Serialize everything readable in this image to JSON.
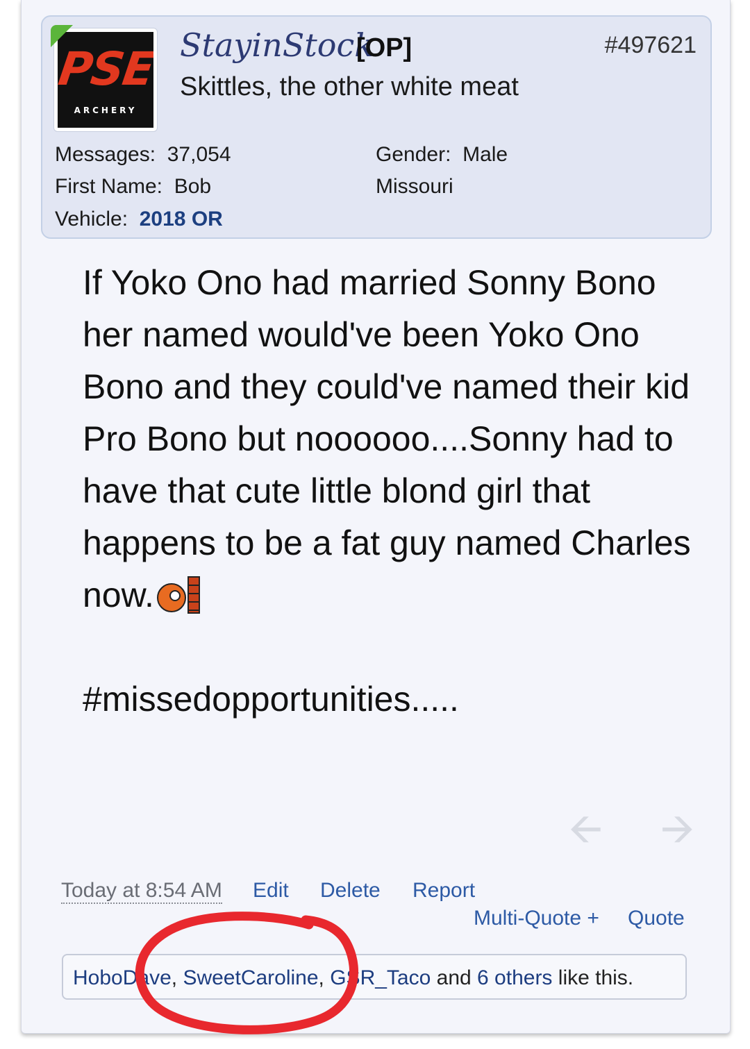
{
  "post": {
    "number": "#497621",
    "message_lines": [
      "If Yoko Ono had married Sonny Bono her named would've been Yoko Ono Bono and they could've named their kid Pro Bono but noooooo....Sonny had to have that cute little blond girl that happens to be a fat guy named Charles now."
    ],
    "hashtag": "#missedopportunities.....",
    "smiley_icon": "head-bang-wall-icon"
  },
  "user": {
    "avatar_logo": "PSE",
    "avatar_sub": "ARCHERY",
    "name": "StayinStock",
    "op_tag": "[OP]",
    "title": "Skittles, the other white meat",
    "stats": {
      "messages_label": "Messages:",
      "messages_value": "37,054",
      "first_name_label": "First Name:",
      "first_name_value": "Bob",
      "vehicle_label": "Vehicle:",
      "vehicle_value": "2018 OR",
      "gender_label": "Gender:",
      "gender_value": "Male",
      "location": "Missouri"
    }
  },
  "controls": {
    "timestamp": "Today at 8:54 AM",
    "edit": "Edit",
    "delete": "Delete",
    "report": "Report",
    "multi_quote": "Multi-Quote +",
    "quote": "Quote",
    "prev_icon": "arrow-left-icon",
    "next_icon": "arrow-right-icon"
  },
  "likes": {
    "users": [
      "HoboDave",
      "SweetCaroline",
      "GSR_Taco"
    ],
    "sep": ", ",
    "and_text": " and ",
    "others": "6 others",
    "suffix": " like this."
  },
  "colors": {
    "link": "#2d5aa5",
    "username": "#2d3a73",
    "annotation_circle": "#e8282e",
    "userbox_bg": "#e2e6f3"
  }
}
